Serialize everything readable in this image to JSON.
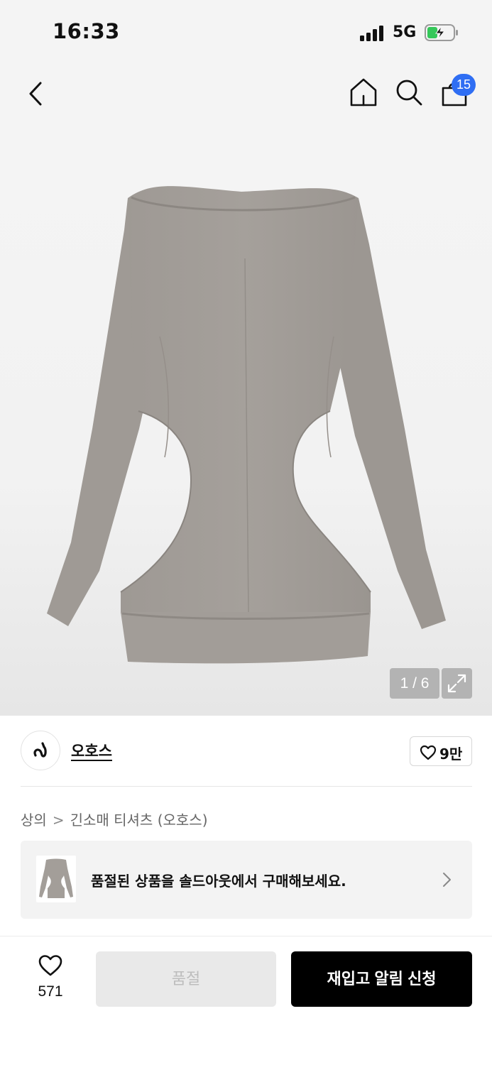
{
  "status_bar": {
    "time": "16:33",
    "network": "5G",
    "battery_state": "charging"
  },
  "nav": {
    "back_icon": "chevron-left-icon",
    "home_icon": "home-icon",
    "search_icon": "search-icon",
    "cart_icon": "shopping-bag-icon",
    "cart_count": "15",
    "badge_color": "#2f6ef3"
  },
  "gallery": {
    "counter": "1 / 6",
    "expand_icon": "expand-icon"
  },
  "brand": {
    "name": "오호스",
    "like_count": "9만"
  },
  "breadcrumb": {
    "category": "상의",
    "subcategory": "긴소매 티셔츠 (오호스)"
  },
  "banner": {
    "text": "품절된 상품을 솔드아웃에서 구매해보세요."
  },
  "bottom_bar": {
    "wishlist_count": "571",
    "soldout_label": "품절",
    "restock_label": "재입고 알림 신청"
  }
}
